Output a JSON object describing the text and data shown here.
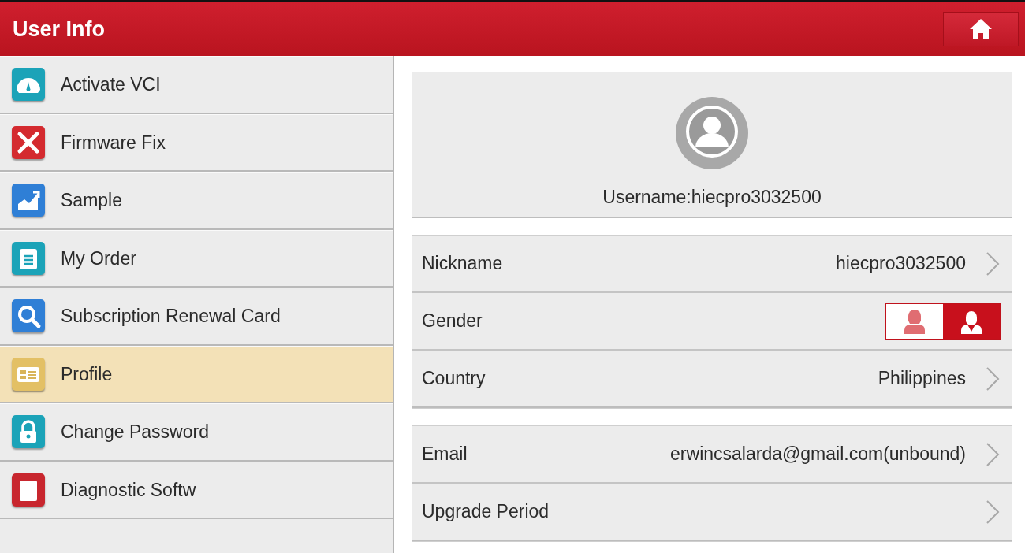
{
  "header": {
    "title": "User Info"
  },
  "sidebar": {
    "items": [
      {
        "label": "Activate VCI",
        "kind": "gauge",
        "color": "#1ba3b8",
        "selected": false
      },
      {
        "label": "Firmware Fix",
        "kind": "tools",
        "color": "#d42a2f",
        "selected": false
      },
      {
        "label": "Sample",
        "kind": "chart",
        "color": "#2f7fd6",
        "selected": false
      },
      {
        "label": "My Order",
        "kind": "clipboard",
        "color": "#1ba3b8",
        "selected": false
      },
      {
        "label": "Subscription Renewal Card",
        "kind": "search",
        "color": "#2f7fd6",
        "selected": false
      },
      {
        "label": "Profile",
        "kind": "card",
        "color": "#e3c065",
        "selected": true
      },
      {
        "label": "Change Password",
        "kind": "lock",
        "color": "#1ba3b8",
        "selected": false
      },
      {
        "label": "Diagnostic Softw",
        "kind": "document",
        "color": "#c8262e",
        "selected": false
      }
    ]
  },
  "profile": {
    "username": "Username:hiecpro3032500"
  },
  "groups": [
    {
      "rows": [
        {
          "label": "Nickname",
          "kind": "value",
          "value": "hiecpro3032500"
        },
        {
          "label": "Gender",
          "kind": "gender",
          "options": [
            {
              "kind": "female",
              "selected": false
            },
            {
              "kind": "male",
              "selected": true
            }
          ]
        },
        {
          "label": "Country",
          "kind": "value",
          "value": "Philippines"
        }
      ]
    },
    {
      "rows": [
        {
          "label": "Email",
          "kind": "value",
          "value": "erwincsalarda@gmail.com(unbound)"
        },
        {
          "label": "Upgrade Period",
          "kind": "value"
        }
      ]
    }
  ]
}
